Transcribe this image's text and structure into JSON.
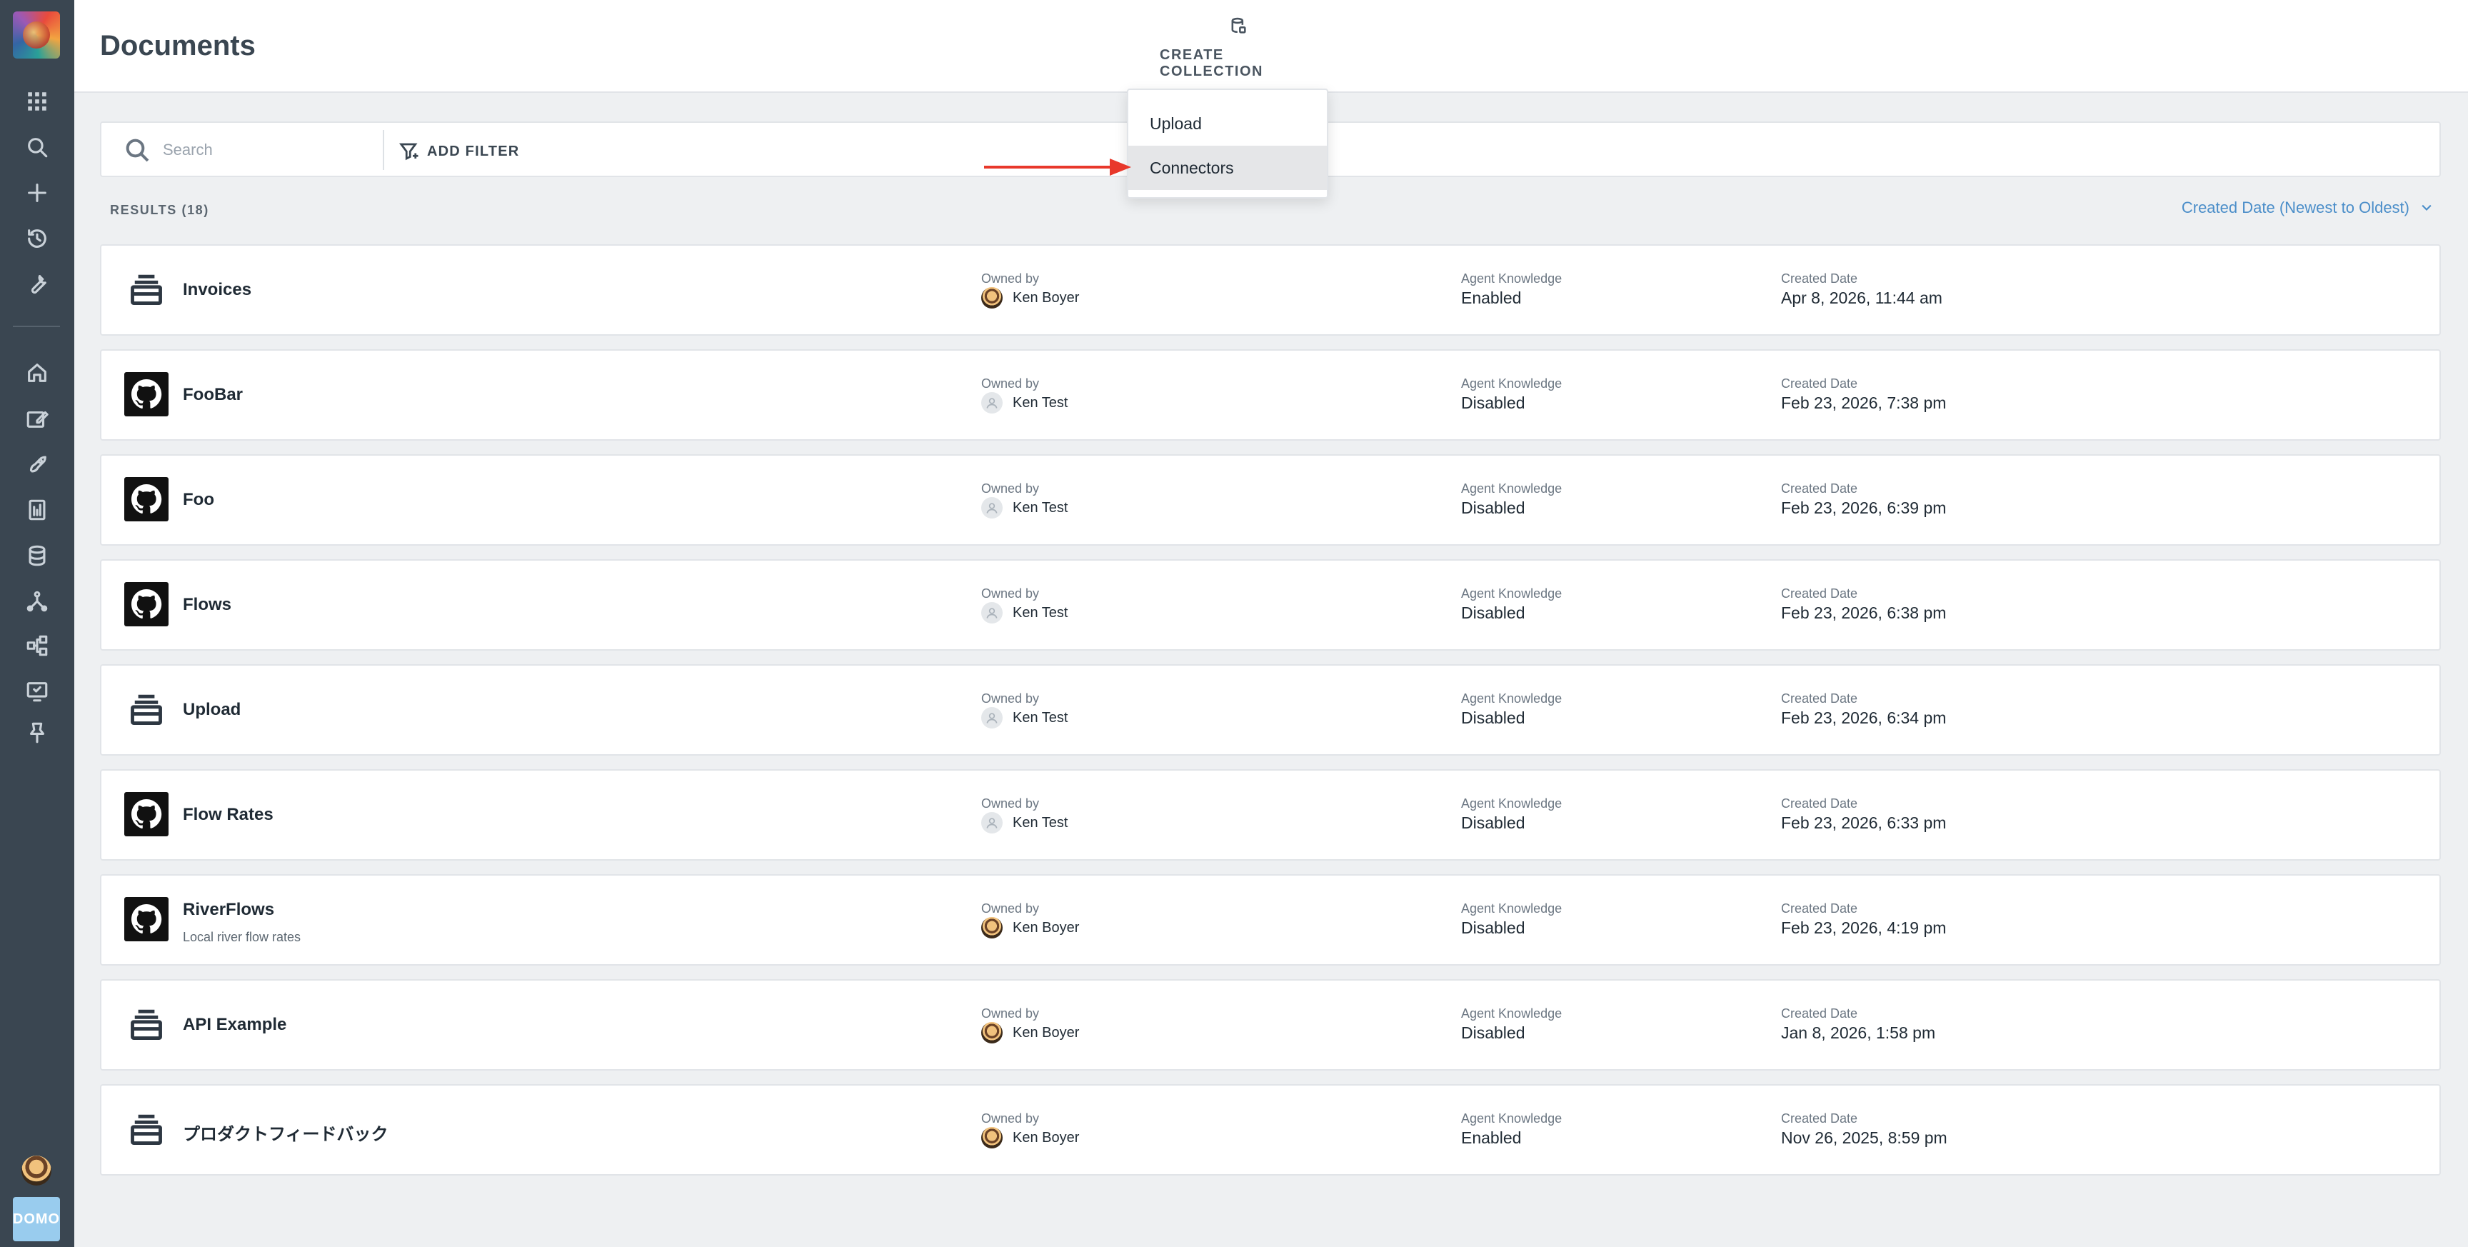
{
  "header": {
    "title": "Documents",
    "create_collection_label": "CREATE COLLECTION"
  },
  "create_menu": {
    "items": [
      {
        "label": "Upload",
        "hovered": false
      },
      {
        "label": "Connectors",
        "hovered": true
      }
    ]
  },
  "search": {
    "placeholder": "Search",
    "value": "",
    "add_filter_label": "ADD FILTER"
  },
  "results": {
    "count_label": "RESULTS (18)",
    "sort_label": "Created Date (Newest to Oldest)",
    "column_labels": {
      "owner": "Owned by",
      "agent_knowledge": "Agent Knowledge",
      "created": "Created Date"
    },
    "rows": [
      {
        "name": "Invoices",
        "subtitle": "",
        "type_icon": "stack-icon",
        "owner": "Ken Boyer",
        "owner_avatar": "photo",
        "agent_knowledge": "Enabled",
        "created": "Apr 8, 2026, 11:44 am"
      },
      {
        "name": "FooBar",
        "subtitle": "",
        "type_icon": "github-icon",
        "owner": "Ken Test",
        "owner_avatar": "blank",
        "agent_knowledge": "Disabled",
        "created": "Feb 23, 2026, 7:38 pm"
      },
      {
        "name": "Foo",
        "subtitle": "",
        "type_icon": "github-icon",
        "owner": "Ken Test",
        "owner_avatar": "blank",
        "agent_knowledge": "Disabled",
        "created": "Feb 23, 2026, 6:39 pm"
      },
      {
        "name": "Flows",
        "subtitle": "",
        "type_icon": "github-icon",
        "owner": "Ken Test",
        "owner_avatar": "blank",
        "agent_knowledge": "Disabled",
        "created": "Feb 23, 2026, 6:38 pm"
      },
      {
        "name": "Upload",
        "subtitle": "",
        "type_icon": "stack-icon",
        "owner": "Ken Test",
        "owner_avatar": "blank",
        "agent_knowledge": "Disabled",
        "created": "Feb 23, 2026, 6:34 pm"
      },
      {
        "name": "Flow Rates",
        "subtitle": "",
        "type_icon": "github-icon",
        "owner": "Ken Test",
        "owner_avatar": "blank",
        "agent_knowledge": "Disabled",
        "created": "Feb 23, 2026, 6:33 pm"
      },
      {
        "name": "RiverFlows",
        "subtitle": "Local river flow rates",
        "type_icon": "github-icon",
        "owner": "Ken Boyer",
        "owner_avatar": "photo",
        "agent_knowledge": "Disabled",
        "created": "Feb 23, 2026, 4:19 pm"
      },
      {
        "name": "API Example",
        "subtitle": "",
        "type_icon": "stack-icon",
        "owner": "Ken Boyer",
        "owner_avatar": "photo",
        "agent_knowledge": "Disabled",
        "created": "Jan 8, 2026, 1:58 pm"
      },
      {
        "name": "プロダクトフィードバック",
        "subtitle": "",
        "type_icon": "stack-icon",
        "owner": "Ken Boyer",
        "owner_avatar": "photo",
        "agent_knowledge": "Enabled",
        "created": "Nov 26, 2025, 8:59 pm"
      }
    ]
  },
  "rail": {
    "brand_label": "DOMO",
    "icons": [
      "apps-grid-icon",
      "search-icon",
      "plus-icon",
      "history-icon",
      "wrench-icon",
      "home-icon",
      "edit-card-icon",
      "rocket-icon",
      "report-icon",
      "database-icon",
      "dataflow-icon",
      "workflow-icon",
      "monitor-icon",
      "pin-icon"
    ]
  },
  "colors": {
    "rail_bg": "#3a4651",
    "accent_link": "#4b8ec9",
    "annotation_arrow": "#e8382b"
  }
}
